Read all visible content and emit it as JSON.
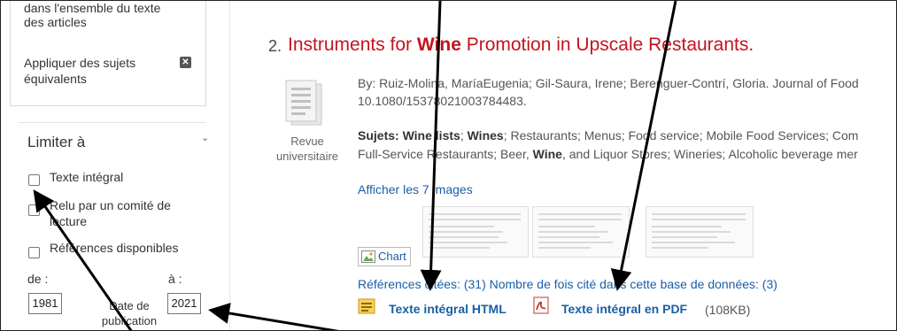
{
  "sidebar": {
    "facet_text": "dans l'ensemble du texte des articles",
    "apply_equiv": "Appliquer des sujets équivalents",
    "remove_icon": "close-icon",
    "limit_title": "Limiter à",
    "limit_chevron": "chevron-down-icon",
    "limits": [
      {
        "label": "Texte intégral",
        "checked": false
      },
      {
        "label": "Relu par un comité de lecture",
        "checked": false
      },
      {
        "label": "Références disponibles",
        "checked": false
      }
    ],
    "date": {
      "from_label": "de :",
      "to_label": "à :",
      "from_value": "1981",
      "to_value": "2021",
      "caption": "Date de publication"
    }
  },
  "result": {
    "number": "2.",
    "title_pre": "Instruments for ",
    "title_bold": "Wine",
    "title_post": " Promotion in Upscale Restaurants.",
    "doc_type": "Revue universitaire",
    "authors_line1": "By: Ruiz-Molina, MaríaEugenia; Gil-Saura, Irene; Berenguer-Contrí, Gloria. Journal of Food",
    "authors_line2": "10.1080/15378021003784483.",
    "subjects_label": "Sujets:",
    "subjects_line1_a": " ",
    "subjects_line1_b1": "Wine lists",
    "subjects_line1_c": "; ",
    "subjects_line1_b2": "Wines",
    "subjects_line1_d": "; Restaurants; Menus; Food service; Mobile Food Services; Com",
    "subjects_line2_a": "Full-Service Restaurants; Beer, ",
    "subjects_line2_b": "Wine",
    "subjects_line2_c": ", and Liquor Stores; Wineries; Alcoholic beverage mer",
    "images_link": "Afficher les 7 images",
    "chart_alt": "Chart",
    "refs_link": "Références citées: (31) Nombre de fois cité dans cette base de données: (3)",
    "html_link": "Texte intégral HTML",
    "pdf_link": "Texte intégral en PDF",
    "pdf_size": "(108KB)",
    "html_icon": "html-fulltext-icon",
    "pdf_icon": "pdf-icon"
  },
  "colors": {
    "title_red": "#c5131f",
    "link_blue": "#1a5fa6",
    "arrow_black": "#000000"
  }
}
